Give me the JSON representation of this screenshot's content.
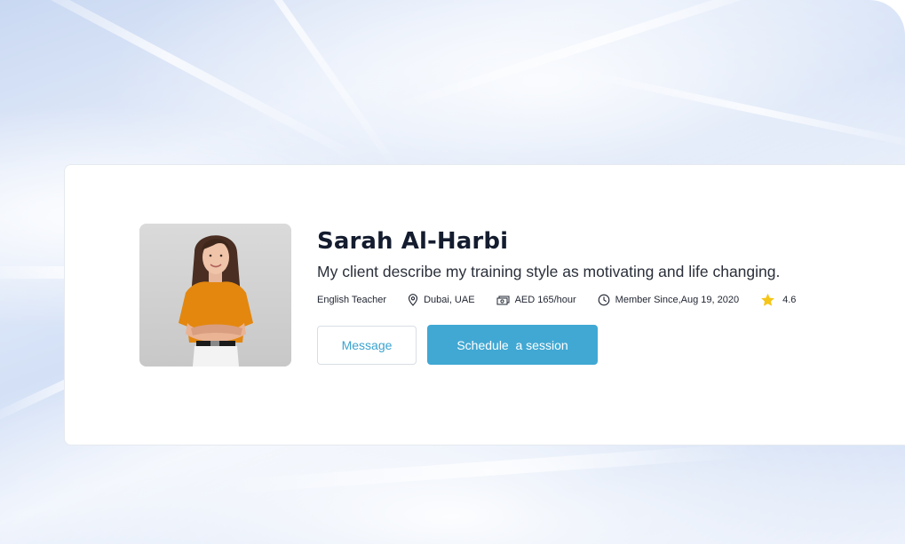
{
  "profile": {
    "name": "Sarah Al-Harbi",
    "tagline": "My client describe my training style as motivating and life changing.",
    "role": "English Teacher",
    "location": "Dubai, UAE",
    "rate": "AED 165/hour",
    "member_since": "Member Since,Aug 19, 2020",
    "rating": "4.6"
  },
  "actions": {
    "message_label": "Message",
    "schedule_label": "Schedule  a session"
  },
  "icons": {
    "location": "location-pin-icon",
    "rate": "money-icon",
    "member_since": "clock-icon",
    "rating": "star-icon"
  },
  "colors": {
    "accent": "#41a8d3",
    "accent_text": "#3aa3cf",
    "star": "#f5c518",
    "name_text": "#141c2f"
  }
}
